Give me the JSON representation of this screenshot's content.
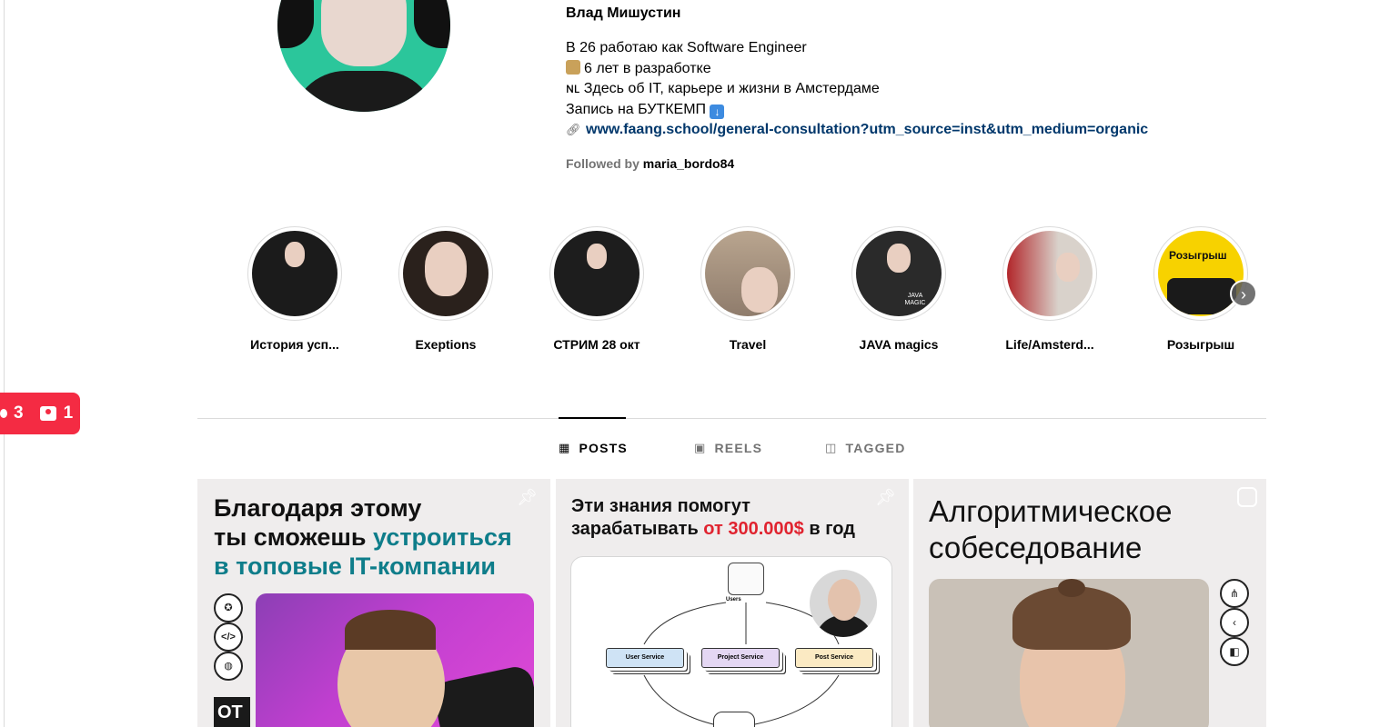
{
  "profile": {
    "name": "Влад Мишустин",
    "bio": [
      "В 26 работаю как Software Engineer",
      "6 лет в разработке",
      "ɴʟ Здесь об IT, карьере и жизни в Амстердаме",
      "Запись на БУТКЕМП"
    ],
    "link": "www.faang.school/general-consultation?utm_source=inst&utm_medium=organic",
    "followed_prefix": "Followed by",
    "followed_user": "maria_bordo84"
  },
  "highlights": [
    {
      "label": "История усп..."
    },
    {
      "label": "Exeptions"
    },
    {
      "label": "СТРИМ 28 окт"
    },
    {
      "label": "Travel"
    },
    {
      "label": "JAVA magics"
    },
    {
      "label": "Life/Amsterd..."
    },
    {
      "label": "Розыгрыш"
    }
  ],
  "highlight_thumbs": {
    "java_text": "JAVA MAGIC",
    "giveaway_title": "Розыгрыш"
  },
  "badge": {
    "comments": "3",
    "contacts": "1"
  },
  "tabs": [
    {
      "label": "POSTS",
      "icon": "grid-icon",
      "active": true
    },
    {
      "label": "REELS",
      "icon": "reels-icon",
      "active": false
    },
    {
      "label": "TAGGED",
      "icon": "tagged-icon",
      "active": false
    }
  ],
  "posts": {
    "p1": {
      "line1": "Благодаря этому",
      "line2a": "ты сможешь ",
      "line2b": "устроиться",
      "line3": "в топовые IT-компании",
      "ot": "ОТ"
    },
    "p2": {
      "line1": "Эти знания помогут",
      "line2a": "зарабатывать ",
      "line2b": "от 300.000$",
      "line2c": " в год",
      "users": "Users",
      "node1": "User Service",
      "node2": "Project Service",
      "node3": "Post Service"
    },
    "p3": {
      "line1": "Алгоритмическое",
      "line2": "собеседование"
    }
  },
  "colors": {
    "accent_teal": "#0e7d8a",
    "accent_red": "#e0232f",
    "badge_red": "#f42b43",
    "link_blue": "#00376b"
  }
}
